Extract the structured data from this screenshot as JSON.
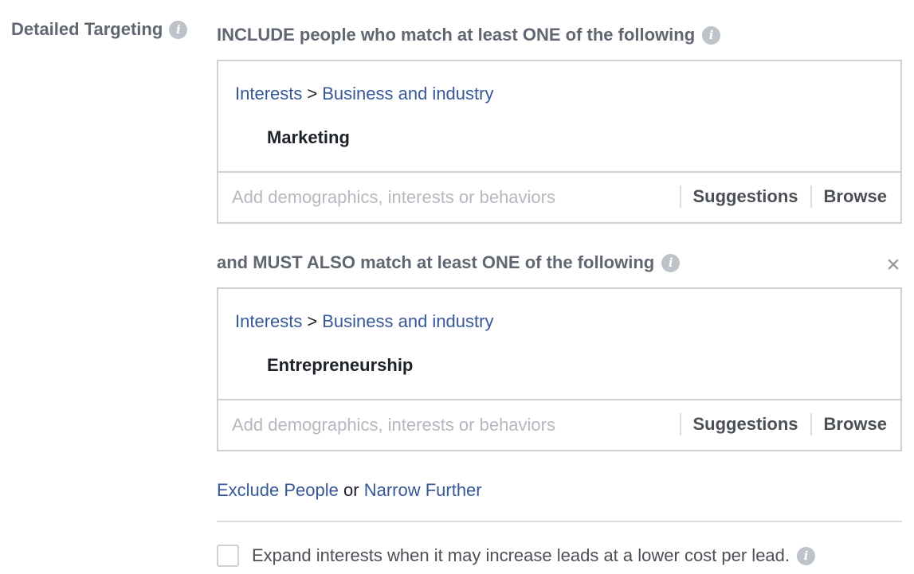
{
  "side_label": "Detailed Targeting",
  "include": {
    "heading": "INCLUDE people who match at least ONE of the following",
    "crumb_1": "Interests",
    "crumb_sep": ">",
    "crumb_2": "Business and industry",
    "item": "Marketing",
    "search_placeholder": "Add demographics, interests or behaviors",
    "suggestions_label": "Suggestions",
    "browse_label": "Browse"
  },
  "narrow": {
    "heading": "and MUST ALSO match at least ONE of the following",
    "close_glyph": "×",
    "crumb_1": "Interests",
    "crumb_sep": ">",
    "crumb_2": "Business and industry",
    "item": "Entrepreneurship",
    "search_placeholder": "Add demographics, interests or behaviors",
    "suggestions_label": "Suggestions",
    "browse_label": "Browse"
  },
  "links": {
    "exclude": "Exclude People",
    "or_text": "or",
    "narrow_further": "Narrow Further"
  },
  "expand": {
    "label": "Expand interests when it may increase leads at a lower cost per lead.",
    "checked": false
  },
  "info_glyph": "i",
  "colors": {
    "link": "#365899",
    "heading": "#606770",
    "border": "#ccd0d5",
    "info_icon": "#bec3c9"
  }
}
